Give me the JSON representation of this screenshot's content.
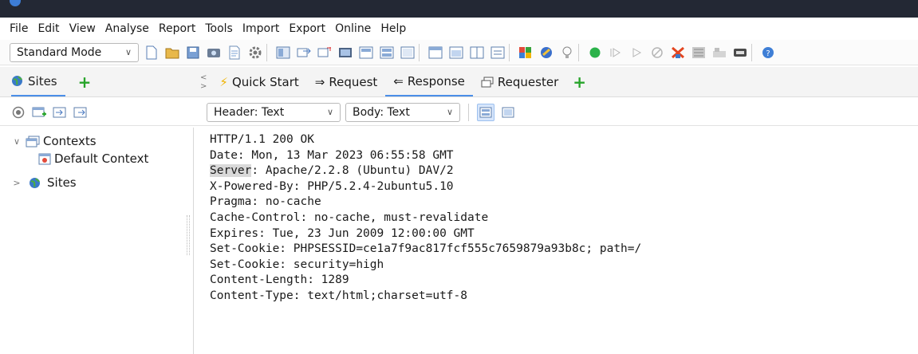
{
  "menu": [
    "File",
    "Edit",
    "View",
    "Analyse",
    "Report",
    "Tools",
    "Import",
    "Export",
    "Online",
    "Help"
  ],
  "toolbar": {
    "mode_value": "Standard Mode"
  },
  "left_panel": {
    "tab_label": "Sites",
    "tree": {
      "contexts_label": "Contexts",
      "default_context_label": "Default Context",
      "sites_label": "Sites"
    }
  },
  "workspace_tabs": {
    "quick_start": "Quick Start",
    "request": "Request",
    "response": "Response",
    "requester": "Requester",
    "active": "Response"
  },
  "response_toolbar": {
    "header_view": "Header: Text",
    "body_view": "Body: Text"
  },
  "response": {
    "status_line": "HTTP/1.1 200 OK",
    "date": "Date: Mon, 13 Mar 2023 06:55:58 GMT",
    "server_key": "Server",
    "server_value": ": Apache/2.2.8 (Ubuntu) DAV/2",
    "powered_by": "X-Powered-By: PHP/5.2.4-2ubuntu5.10",
    "pragma": "Pragma: no-cache",
    "cache_control": "Cache-Control: no-cache, must-revalidate",
    "expires": "Expires: Tue, 23 Jun 2009 12:00:00 GMT",
    "set_cookie_session": "Set-Cookie: PHPSESSID=ce1a7f9ac817fcf555c7659879a93b8c; path=/",
    "set_cookie_security": "Set-Cookie: security=high",
    "content_length": "Content-Length: 1289",
    "content_type": "Content-Type: text/html;charset=utf-8"
  },
  "colors": {
    "accent": "#4b8ee8",
    "add_green": "#27a42a",
    "titlebar": "#232834",
    "highlight": "#d9d9d9"
  }
}
